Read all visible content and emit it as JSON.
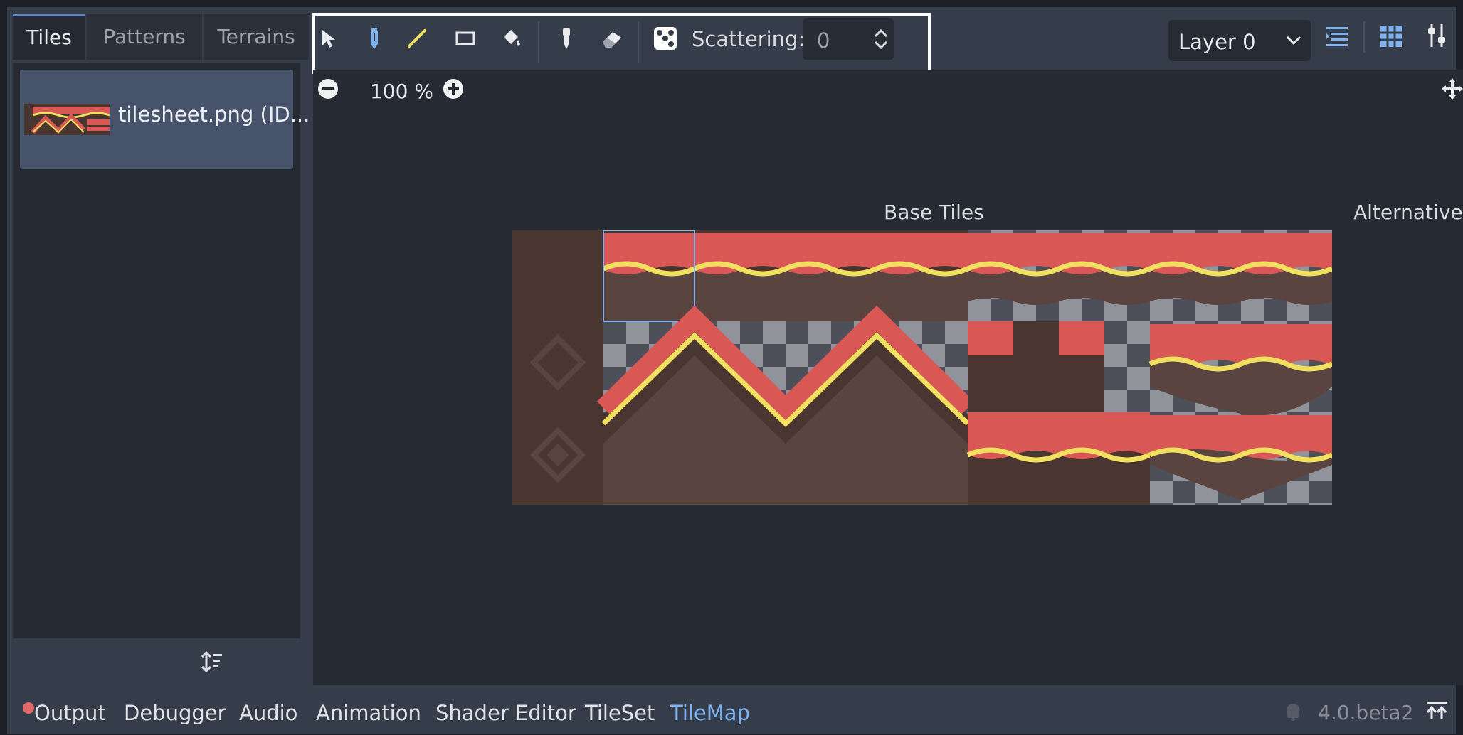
{
  "left_tabs": [
    {
      "label": "Tiles",
      "active": true
    },
    {
      "label": "Patterns",
      "active": false
    },
    {
      "label": "Terrains",
      "active": false
    }
  ],
  "tile_source": {
    "label": "tilesheet.png (ID..."
  },
  "toolbar": {
    "tools": [
      "select-icon",
      "paint-icon",
      "line-icon",
      "rect-icon",
      "bucket-fill-icon",
      "picker-icon",
      "eraser-icon",
      "random-tile-icon"
    ],
    "scattering_label": "Scattering:",
    "scattering_value": "0",
    "layer": "Layer 0"
  },
  "zoom": {
    "label": "100 %"
  },
  "atlas": {
    "base_tiles_label": "Base Tiles",
    "alternative_label": "Alternative"
  },
  "bottom_tabs": [
    "Output",
    "Debugger",
    "Audio",
    "Animation",
    "Shader Editor",
    "TileSet",
    "TileMap"
  ],
  "active_bottom_tab": "TileMap",
  "version": "4.0.beta2",
  "colors": {
    "accent": "#5e86c6",
    "tile_red": "#d95856",
    "tile_yellow": "#f1e05e",
    "tile_brown": "#5a4440",
    "tile_dark_brown": "#4a3631",
    "output_dot": "#e46a6a"
  }
}
